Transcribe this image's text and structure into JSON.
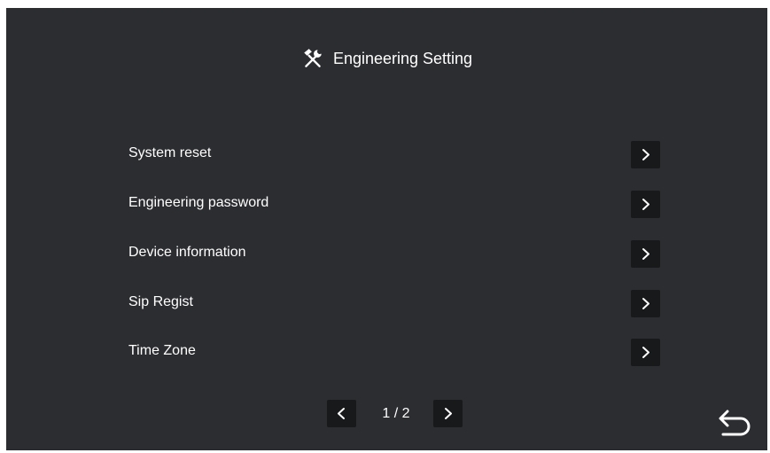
{
  "header": {
    "title": "Engineering Setting",
    "icon": "tools-icon"
  },
  "menu": {
    "items": [
      {
        "label": "System reset",
        "icon": "chevron-right-icon"
      },
      {
        "label": "Engineering password",
        "icon": "chevron-right-icon"
      },
      {
        "label": "Device information",
        "icon": "chevron-right-icon"
      },
      {
        "label": "Sip Regist",
        "icon": "chevron-right-icon"
      },
      {
        "label": "Time Zone",
        "icon": "chevron-right-icon"
      }
    ]
  },
  "pager": {
    "indicator": "1 / 2",
    "prev_icon": "chevron-left-icon",
    "next_icon": "chevron-right-icon"
  },
  "back": {
    "icon": "back-arrow-icon"
  },
  "colors": {
    "background": "#2c2d31",
    "button": "#18191b",
    "text": "#ffffff"
  }
}
